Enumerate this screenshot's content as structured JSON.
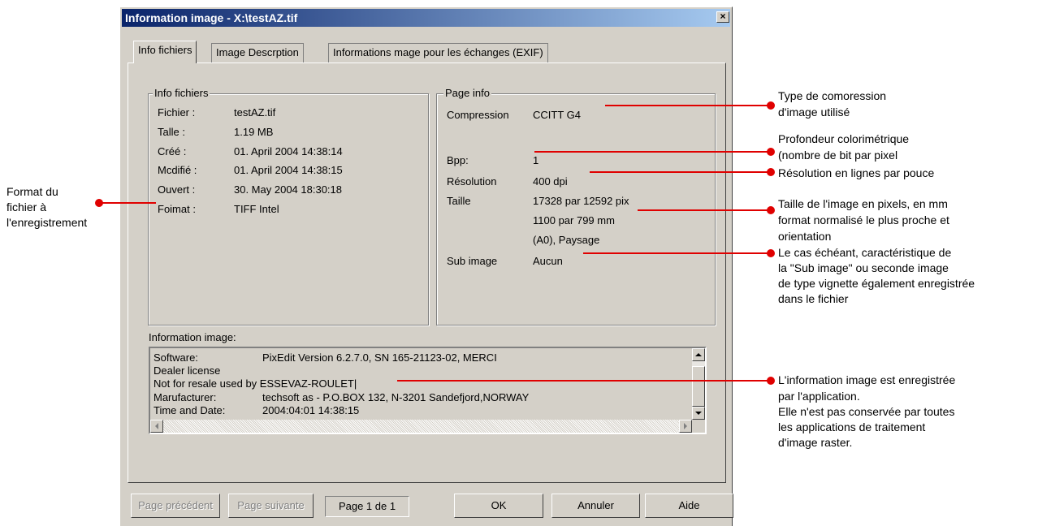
{
  "dialog": {
    "title": "Information image - X:\\testAZ.tif",
    "close_label": "×",
    "tabs": [
      {
        "label": "Info fichiers"
      },
      {
        "label": "Image Descrption"
      },
      {
        "label": "Informations mage pour les échanges (EXIF)"
      }
    ],
    "file_info": {
      "title": "Info fichiers",
      "rows": [
        {
          "label": "Fichier :",
          "value": "testAZ.tif"
        },
        {
          "label": "Talle :",
          "value": "1.19 MB"
        },
        {
          "label": "Créé :",
          "value": "01. April 2004 14:38:14"
        },
        {
          "label": "Mcdifié :",
          "value": "01. April 2004 14:38:15"
        },
        {
          "label": "Ouvert :",
          "value": "30. May 2004 18:30:18"
        },
        {
          "label": "Foimat :",
          "value": "TIFF Intel"
        }
      ]
    },
    "page_info": {
      "title": "Page info",
      "compression_label": "Compression",
      "compression_value": "CCITT G4",
      "bpp_label": "Bpp:",
      "bpp_value": "1",
      "resolution_label": "Résolution",
      "resolution_value": "400 dpi",
      "size_label": "Taille",
      "size_pixels": "17328 par 12592 pix",
      "size_mm": "1100 par 799 mm",
      "size_format": "(A0), Paysage",
      "subimage_label": "Sub image",
      "subimage_value": "Aucun"
    },
    "image_info": {
      "title": "Information image:",
      "lines": [
        {
          "key": "Software:",
          "value": "PixEdit Version 6.2.7.0, SN 165-21123-02, MERCI"
        },
        {
          "key": "Dealer license",
          "value": ""
        },
        {
          "key": "Not for resale used by ESSEVAZ-ROULET|",
          "value": ""
        },
        {
          "key": "Marufacturer:",
          "value": "techsoft as - P.O.BOX 132, N-3201 Sandefjord,NORWAY"
        },
        {
          "key": "Time and Date:",
          "value": "2004:04:01 14:38:15"
        }
      ]
    },
    "buttons": {
      "prev": "Page précédent",
      "next": "Page suivante",
      "page_indicator": "Page 1 de 1",
      "ok": "OK",
      "cancel": "Annuler",
      "help": "Aide"
    }
  },
  "annotations": {
    "format": [
      "Format du",
      "fichier à",
      "l'enregistrement"
    ],
    "compression": [
      "Type de comoression",
      "d'image utilisé"
    ],
    "bpp": [
      "Profondeur colorimétrique",
      "(nombre de bit par pixel"
    ],
    "resolution": [
      "Résolution en lignes par pouce"
    ],
    "size": [
      "Taille de l'image en pixels, en mm",
      "format normalisé le plus proche et",
      "orientation"
    ],
    "subimage": [
      "Le cas échéant, caractéristique de",
      "la \"Sub image\" ou seconde image",
      "de type vignette également enregistrée",
      "dans le fichier"
    ],
    "info": [
      "L'information image est enregistrée",
      "par l'application.",
      "Elle n'est pas conservée par toutes",
      "les applications de traitement",
      "d'image raster."
    ]
  },
  "colors": {
    "annotation": "#e00000",
    "title_bar_start": "#0a246a",
    "title_bar_end": "#a6caf0",
    "face": "#d4d0c8"
  }
}
